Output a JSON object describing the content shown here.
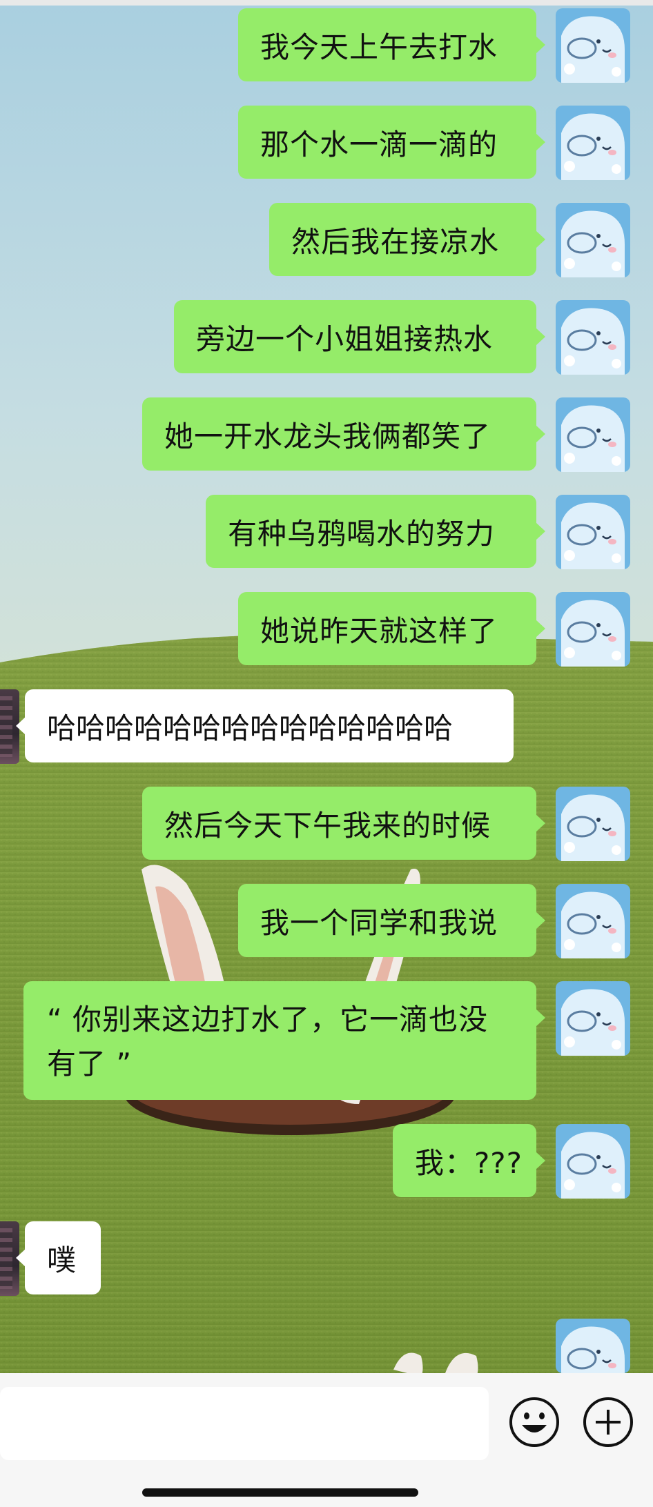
{
  "messages": [
    {
      "sender": "me",
      "text": "我今天上午去打水"
    },
    {
      "sender": "me",
      "text": "那个水一滴一滴的"
    },
    {
      "sender": "me",
      "text": "然后我在接凉水"
    },
    {
      "sender": "me",
      "text": "旁边一个小姐姐接热水"
    },
    {
      "sender": "me",
      "text": "她一开水龙头我俩都笑了"
    },
    {
      "sender": "me",
      "text": "有种乌鸦喝水的努力"
    },
    {
      "sender": "me",
      "text": "她说昨天就这样了"
    },
    {
      "sender": "other",
      "text": "哈哈哈哈哈哈哈哈哈哈哈哈哈哈"
    },
    {
      "sender": "me",
      "text": "然后今天下午我来的时候"
    },
    {
      "sender": "me",
      "text": "我一个同学和我说"
    },
    {
      "sender": "me",
      "text": "“ 你别来这边打水了，它一滴也没有了 ”"
    },
    {
      "sender": "me",
      "text": "我：???"
    },
    {
      "sender": "other",
      "text": "噗"
    }
  ],
  "input": {
    "value": ""
  },
  "icons": {
    "emoji": "smiley-face-icon",
    "plus": "plus-circle-icon"
  },
  "colors": {
    "my_bubble": "#95ec69",
    "their_bubble": "#ffffff",
    "bar": "#f6f6f6"
  }
}
